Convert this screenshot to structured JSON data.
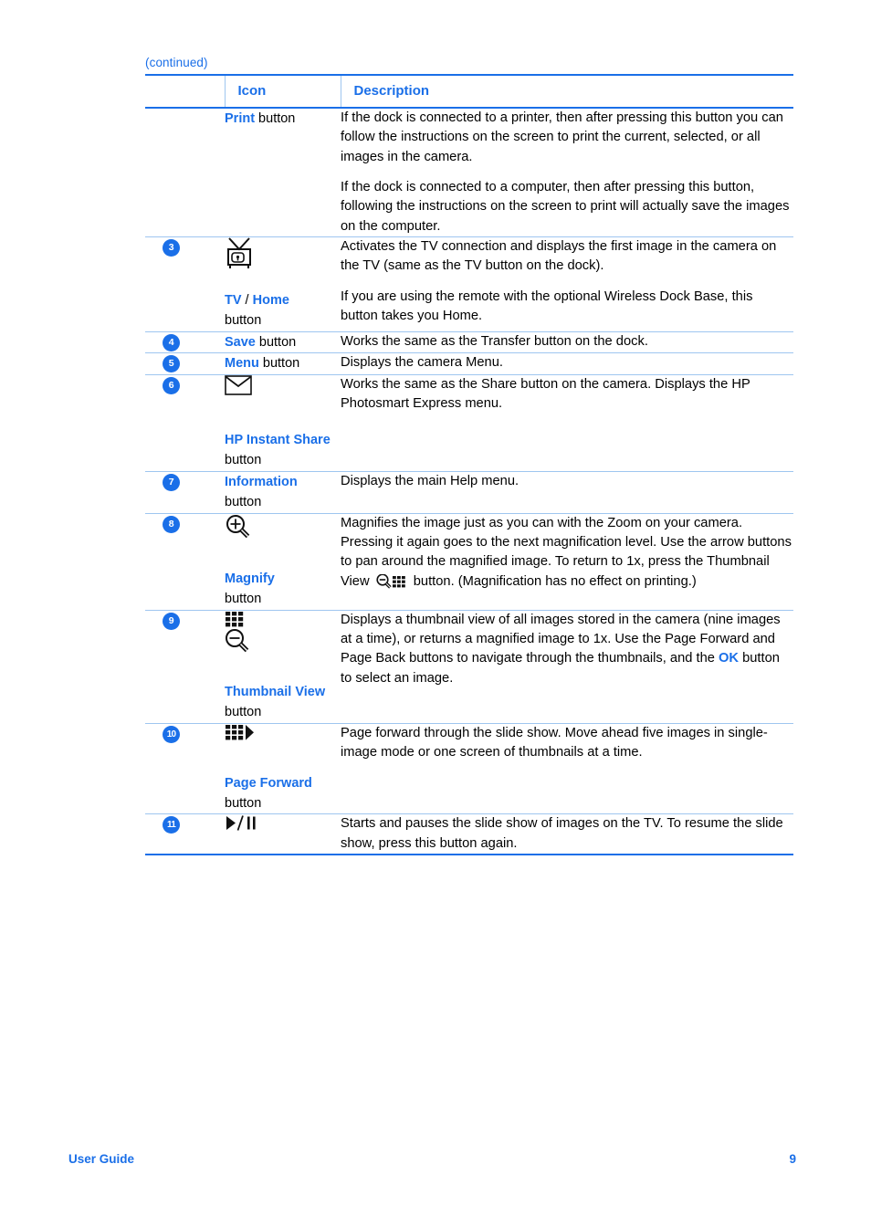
{
  "page": {
    "continued_label": "(continued)",
    "footer_left": "User Guide",
    "footer_page_number": "9",
    "accent_color": "#1a6fe8",
    "rule_color": "#9fc6f0"
  },
  "table": {
    "headers": {
      "number": "",
      "icon": "Icon",
      "description": "Description"
    },
    "rows": [
      {
        "number": "",
        "icon_name": "",
        "label_bold": "Print",
        "label_rest": " button",
        "paragraphs": [
          "If the dock is connected to a printer, then after pressing this button you can follow the instructions on the screen to print the current, selected, or all images in the camera.",
          "If the dock is connected to a computer, then after pressing this button, following the instructions on the screen to print will actually save the images on the computer."
        ]
      },
      {
        "number": "3",
        "icon_name": "tv-icon",
        "label_bold": "TV",
        "label_sep": " / ",
        "label_bold2": "Home",
        "label_rest": "button",
        "paragraphs": [
          "Activates the TV connection and displays the first image in the camera on the TV (same as the TV button on the dock).",
          "If you are using the remote with the optional Wireless Dock Base, this button takes you Home."
        ]
      },
      {
        "number": "4",
        "icon_name": "",
        "label_bold": "Save",
        "label_rest": " button",
        "paragraphs": [
          "Works the same as the Transfer button on the dock."
        ]
      },
      {
        "number": "5",
        "icon_name": "",
        "label_bold": "Menu",
        "label_rest": " button",
        "paragraphs": [
          "Displays the camera Menu."
        ]
      },
      {
        "number": "6",
        "icon_name": "envelope-icon",
        "label_bold": "HP Instant Share",
        "label_rest": " button",
        "paragraphs": [
          "Works the same as the Share button on the camera. Displays the HP Photosmart Express menu."
        ]
      },
      {
        "number": "7",
        "icon_name": "",
        "label_bold": "Information",
        "label_rest": "button",
        "paragraphs": [
          "Displays the main Help menu."
        ]
      },
      {
        "number": "8",
        "icon_name": "magnify-plus-icon",
        "label_bold": "Magnify",
        "label_rest": "button",
        "desc_part1": "Magnifies the image just as you can with the Zoom on your camera. Pressing it again goes to the next magnification level. Use the arrow buttons to pan around the magnified image. To return to 1x, press the Thumbnail View ",
        "desc_inline_icon": "thumbnail-view-icon",
        "desc_part2": " button. (Magnification has no effect on printing.)"
      },
      {
        "number": "9",
        "icon_name": "thumbnail-view-icon",
        "label_bold": "Thumbnail View",
        "label_rest": " button",
        "desc_part1": "Displays a thumbnail view of all images stored in the camera (nine images at a time), or returns a magnified image to 1x. Use the Page Forward and Page Back buttons to navigate through the thumbnails, and the ",
        "desc_bold": "OK",
        "desc_part2": " button to select an image."
      },
      {
        "number": "10",
        "icon_name": "page-forward-icon",
        "label_bold": "Page Forward",
        "label_rest": "button",
        "paragraphs": [
          "Page forward through the slide show. Move ahead five images in single-image mode or one screen of thumbnails at a time."
        ]
      },
      {
        "number": "11",
        "icon_name": "play-pause-icon",
        "label_bold": "",
        "label_rest": "",
        "paragraphs": [
          "Starts and pauses the slide show of images on the TV. To resume the slide show, press this button again."
        ]
      }
    ]
  }
}
